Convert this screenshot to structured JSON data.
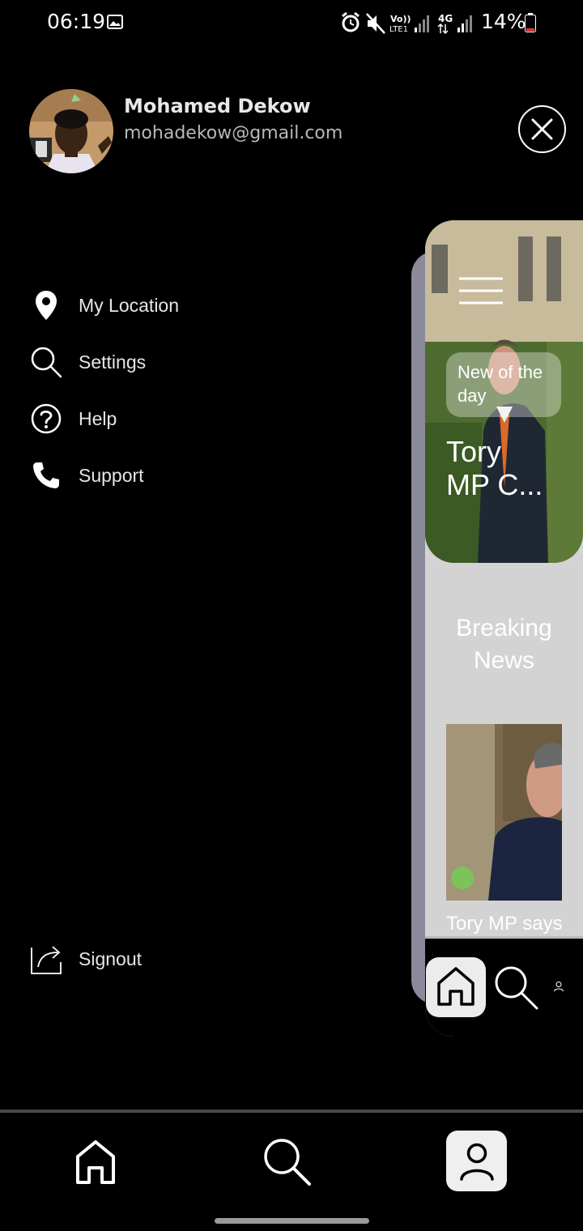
{
  "status_bar": {
    "time": "06:19",
    "battery": "14%",
    "icons": [
      "image-icon",
      "alarm-icon",
      "mute-icon",
      "volte-icon",
      "signal-icon",
      "4g-icon",
      "signal-icon"
    ]
  },
  "profile": {
    "name": "Mohamed Dekow",
    "email": "mohadekow@gmail.com"
  },
  "menu": {
    "items": [
      {
        "label": "My Location",
        "icon": "location-pin-icon"
      },
      {
        "label": "Settings",
        "icon": "search-icon"
      },
      {
        "label": "Help",
        "icon": "help-circle-icon"
      },
      {
        "label": "Support",
        "icon": "phone-icon"
      }
    ],
    "signout_label": "Signout"
  },
  "preview": {
    "badge": "New of the day",
    "hero_title": "Tory\nMP C...",
    "section_title": "Breaking\nNews",
    "thumb_caption": "Tory MP says"
  },
  "colors": {
    "background": "#000000",
    "preview_bg": "#d3d3d3",
    "active_tab": "#efefef",
    "battery_low": "#e53935"
  }
}
